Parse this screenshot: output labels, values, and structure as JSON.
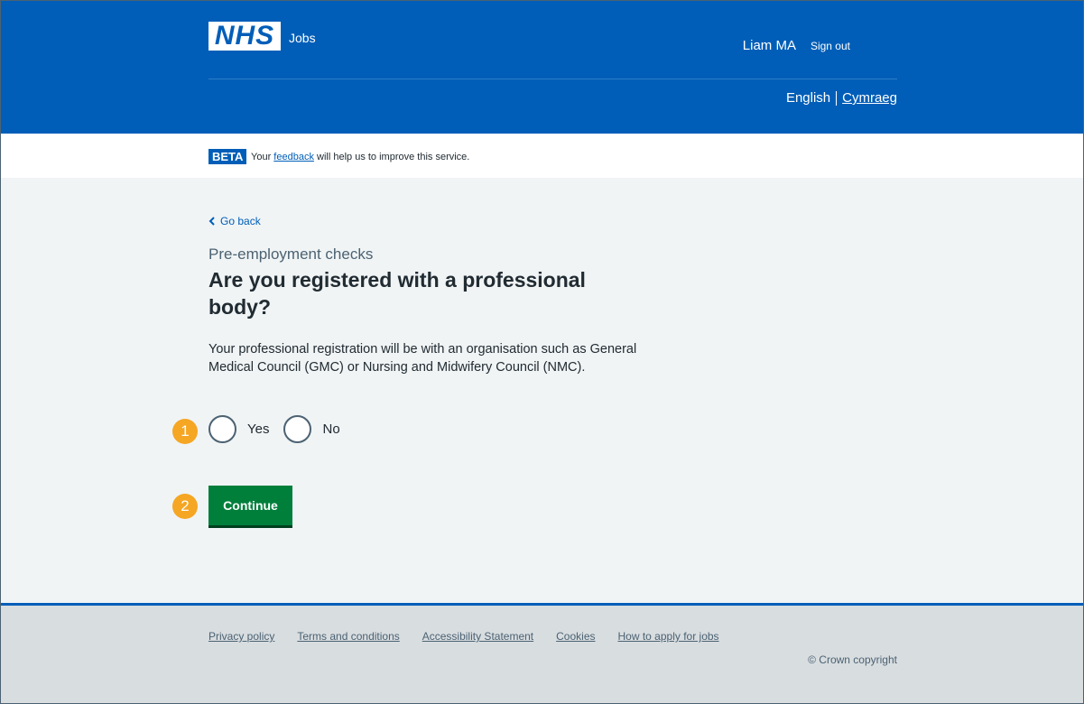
{
  "header": {
    "logo": "NHS",
    "service_name": "Jobs",
    "user_name": "Liam MA",
    "sign_out": "Sign out",
    "lang_current": "English",
    "lang_alt": "Cymraeg"
  },
  "beta": {
    "tag": "BETA",
    "text_before": "Your",
    "link": "feedback",
    "text_after": "will help us to improve this service."
  },
  "main": {
    "back": "Go back",
    "caption": "Pre-employment checks",
    "heading": "Are you registered with a professional body?",
    "hint": "Your professional registration will be with an organisation such as General Medical Council (GMC) or Nursing and Midwifery Council (NMC).",
    "options": [
      {
        "label": "Yes",
        "selected": false
      },
      {
        "label": "No",
        "selected": false
      }
    ],
    "continue": "Continue",
    "badges": [
      "1",
      "2"
    ]
  },
  "footer": {
    "links": [
      "Privacy policy",
      "Terms and conditions",
      "Accessibility Statement",
      "Cookies",
      "How to apply for jobs"
    ],
    "copyright": "© Crown copyright"
  },
  "colors": {
    "nhs_blue": "#005eb8",
    "button_green": "#007f3b",
    "badge_orange": "#f5a623"
  }
}
